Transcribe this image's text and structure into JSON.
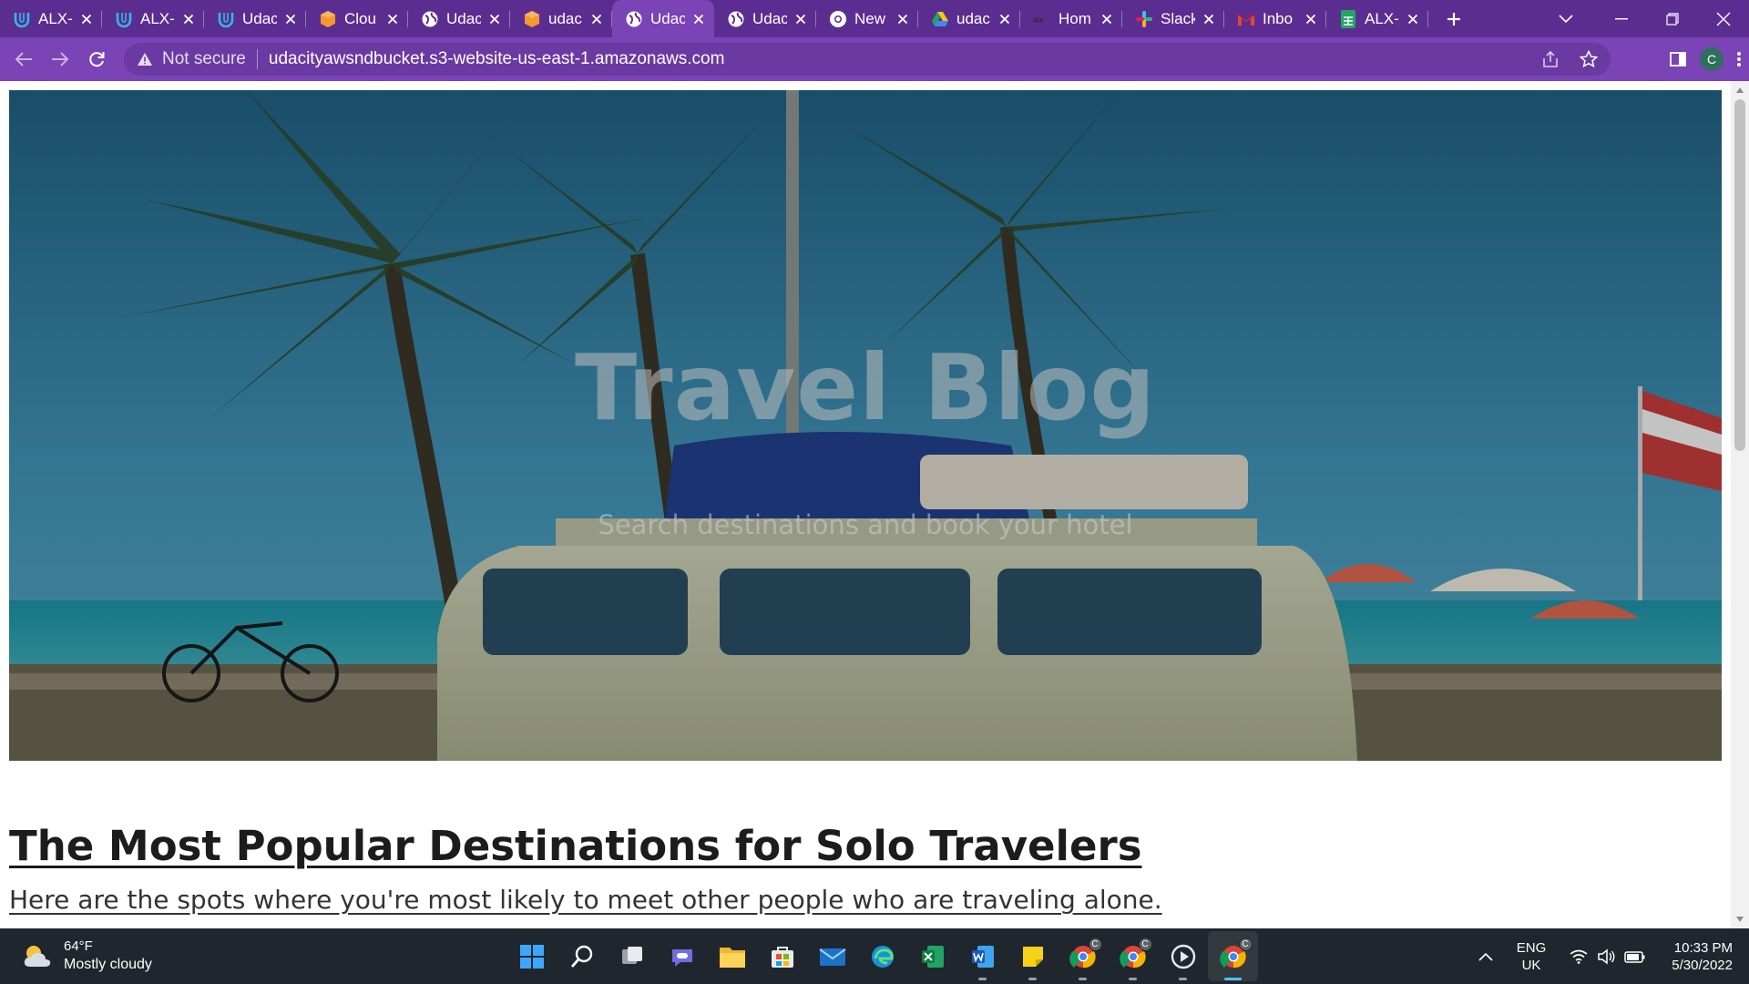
{
  "browser": {
    "tabs": [
      {
        "title": "ALX-",
        "icon": "udacity-icon",
        "active": false
      },
      {
        "title": "ALX-",
        "icon": "udacity-icon",
        "active": false
      },
      {
        "title": "Udac",
        "icon": "udacity-icon",
        "active": false
      },
      {
        "title": "Clou",
        "icon": "aws-cube-icon",
        "active": false
      },
      {
        "title": "Udac",
        "icon": "globe-icon",
        "active": false
      },
      {
        "title": "udac",
        "icon": "aws-cube-icon",
        "active": false
      },
      {
        "title": "Udac",
        "icon": "globe-icon",
        "active": true
      },
      {
        "title": "Udac",
        "icon": "globe-icon",
        "active": false
      },
      {
        "title": "New",
        "icon": "chrome-icon",
        "active": false
      },
      {
        "title": "udac",
        "icon": "google-drive-icon",
        "active": false
      },
      {
        "title": "Hom",
        "icon": "alx-logo-icon",
        "active": false
      },
      {
        "title": "Slack",
        "icon": "slack-icon",
        "active": false
      },
      {
        "title": "Inbo",
        "icon": "gmail-icon",
        "active": false
      },
      {
        "title": "ALX-",
        "icon": "google-sheets-icon",
        "active": false
      }
    ],
    "security_label": "Not secure",
    "url": "udacityawsndbucket.s3-website-us-east-1.amazonaws.com",
    "profile_initial": "C"
  },
  "page": {
    "hero_title": "Travel Blog",
    "hero_subtitle": "Search destinations and book your hotel",
    "article_title": "The Most Popular Destinations for Solo Travelers",
    "article_subtitle": "Here are the spots where you're most likely to meet other people who are traveling alone."
  },
  "taskbar": {
    "weather_temp": "64°F",
    "weather_desc": "Mostly cloudy",
    "apps": [
      {
        "icon": "windows-start-icon",
        "running": false
      },
      {
        "icon": "search-icon",
        "running": false
      },
      {
        "icon": "task-view-icon",
        "running": false
      },
      {
        "icon": "teams-chat-icon",
        "running": false
      },
      {
        "icon": "file-explorer-icon",
        "running": false
      },
      {
        "icon": "microsoft-store-icon",
        "running": false
      },
      {
        "icon": "mail-icon",
        "running": false
      },
      {
        "icon": "edge-icon",
        "running": false
      },
      {
        "icon": "excel-icon",
        "running": false
      },
      {
        "icon": "word-icon",
        "running": true
      },
      {
        "icon": "sticky-notes-icon",
        "running": true
      },
      {
        "icon": "chrome-profile-icon",
        "running": true
      },
      {
        "icon": "chrome-profile-icon",
        "running": true
      },
      {
        "icon": "media-player-icon",
        "running": true
      },
      {
        "icon": "chrome-profile-icon",
        "running": true,
        "active": true
      }
    ],
    "chrome_badge": "C",
    "lang_top": "ENG",
    "lang_bottom": "UK",
    "time": "10:33 PM",
    "date": "5/30/2022"
  },
  "colors": {
    "tabstrip": "#5c2d91",
    "toolbar": "#7a43b6",
    "taskbar": "#20262e"
  }
}
